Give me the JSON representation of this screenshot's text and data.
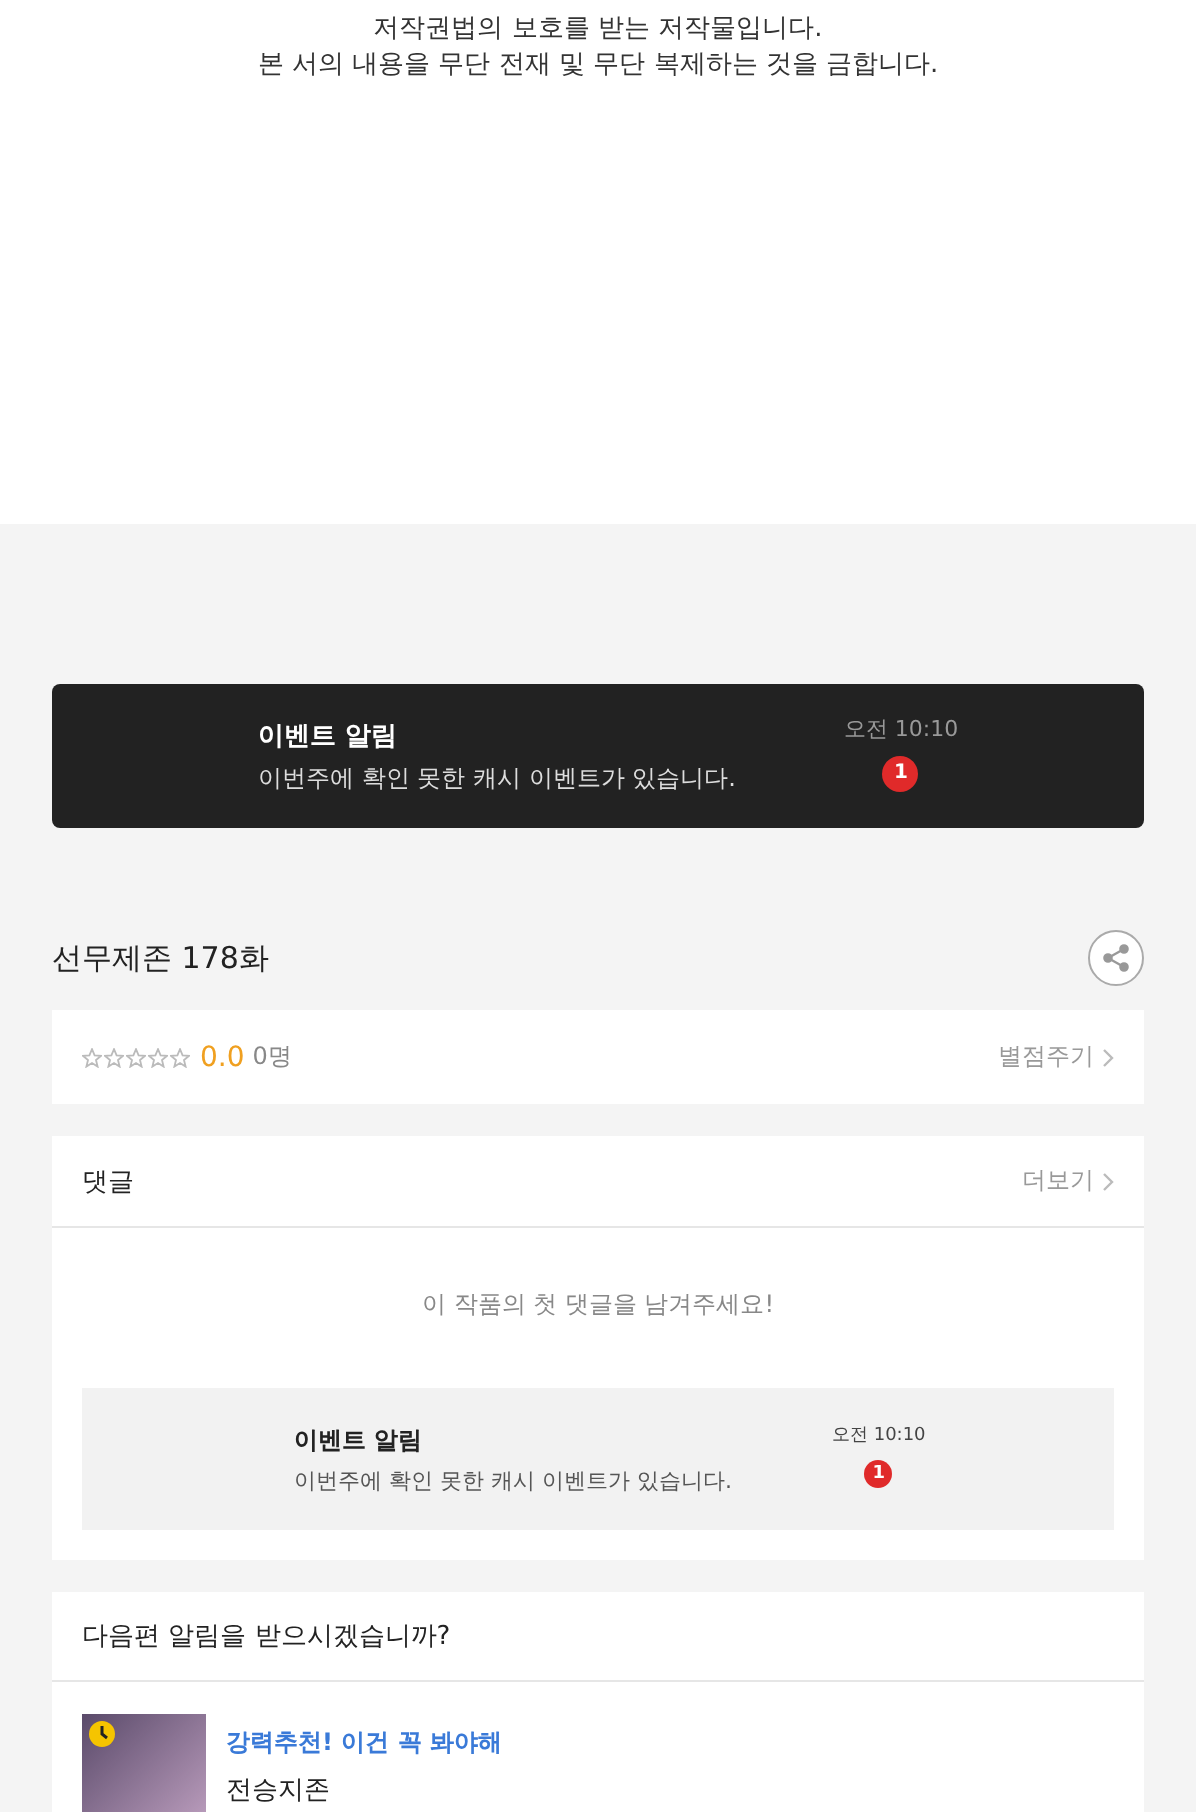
{
  "copyright": [
    "저작권법의 보호를 받는 저작물입니다.",
    "본 서의 내용을 무단 전재 및 무단 복제하는 것을 금합니다."
  ],
  "event_banner": {
    "title": "이벤트 알림",
    "message": "이번주에 확인 못한 캐시 이벤트가 있습니다.",
    "time": "오전 10:10",
    "badge": "1"
  },
  "episode": {
    "title": "선무제존 178화"
  },
  "rating": {
    "stars": 0,
    "score": "0.0",
    "count": "0명",
    "action": "별점주기"
  },
  "comments": {
    "title": "댓글",
    "more": "더보기",
    "empty": "이 작품의 첫 댓글을 남겨주세요!",
    "event": {
      "title": "이벤트 알림",
      "message": "이번주에 확인 못한 캐시 이벤트가 있습니다.",
      "time": "오전 10:10",
      "badge": "1"
    }
  },
  "next_alert": {
    "question": "다음편 알림을 받으시겠습니까?",
    "recommend": {
      "tag": "강력추천! 이건 꼭 봐야해",
      "title": "전승지존"
    }
  }
}
